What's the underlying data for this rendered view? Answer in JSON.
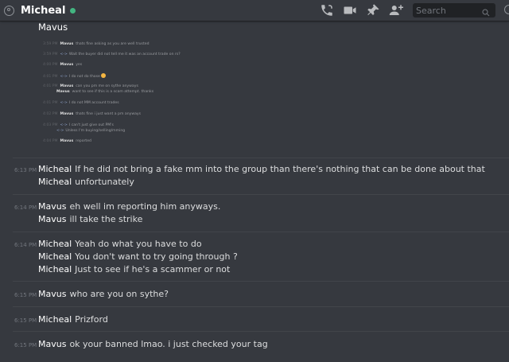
{
  "header": {
    "channel_name": "Micheal",
    "status": "online",
    "search_placeholder": "Search",
    "icons": [
      "call-icon",
      "video-icon",
      "pin-icon",
      "add-friend-icon",
      "search-icon"
    ]
  },
  "first_author": "Mavus",
  "embed": {
    "lines": [
      {
        "ts": "3:59 PM",
        "author": "Mavus",
        "text": "thats fine asking as you are well trusted"
      },
      {
        "ts": "3:59 PM",
        "arrow": "<->",
        "text": "Wait the buyer did not tell me it was an account trade on rs?"
      },
      {
        "ts": "4:00 PM",
        "author": "Mavus",
        "text": "yes"
      },
      {
        "ts": "4:01 PM",
        "arrow": "<->",
        "text": "I do not do those",
        "emoji": true
      },
      {
        "ts": "4:01 PM",
        "author": "Mavus",
        "text": "can you pm me on sythe anyways"
      },
      {
        "ts": "",
        "author": "Mavus",
        "text": "want to see if this is a scam attempt. thanks"
      },
      {
        "ts": "4:01 PM",
        "arrow": "<->",
        "text": "I do not MM account trades"
      },
      {
        "ts": "4:02 PM",
        "author": "Mavus",
        "text": "thats fine i just want a pm anyways"
      },
      {
        "ts": "4:03 PM",
        "arrow": "<->",
        "text": "I can't just give out PM's"
      },
      {
        "ts": "",
        "arrow": "<->",
        "text": "Unless I'm buying/selling/mming"
      },
      {
        "ts": "4:04 PM",
        "author": "Mavus",
        "text": "reported"
      }
    ]
  },
  "messages": [
    {
      "ts": "6:13 PM",
      "lines": [
        {
          "author": "Micheal",
          "text": "If he did not bring a fake mm into the group than there's nothing that can be done about that"
        },
        {
          "author": "Micheal",
          "text": "unfortunately"
        }
      ]
    },
    {
      "ts": "6:14 PM",
      "lines": [
        {
          "author": "Mavus",
          "text": "eh well im reporting him anyways."
        },
        {
          "author": "Mavus",
          "text": "ill take the strike"
        }
      ]
    },
    {
      "ts": "6:14 PM",
      "lines": [
        {
          "author": "Micheal",
          "text": "Yeah do what you have to do"
        },
        {
          "author": "Micheal",
          "text": "You don't want to try going through ?"
        },
        {
          "author": "Micheal",
          "text": "Just to see if he's a scammer or not"
        }
      ]
    },
    {
      "ts": "6:15 PM",
      "lines": [
        {
          "author": "Mavus",
          "text": "who are you on sythe?"
        }
      ]
    },
    {
      "ts": "6:15 PM",
      "lines": [
        {
          "author": "Micheal",
          "text": "Prizford"
        }
      ]
    },
    {
      "ts": "6:15 PM",
      "lines": [
        {
          "author": "Mavus",
          "text": "ok your banned lmao. i just checked your tag"
        }
      ]
    }
  ]
}
